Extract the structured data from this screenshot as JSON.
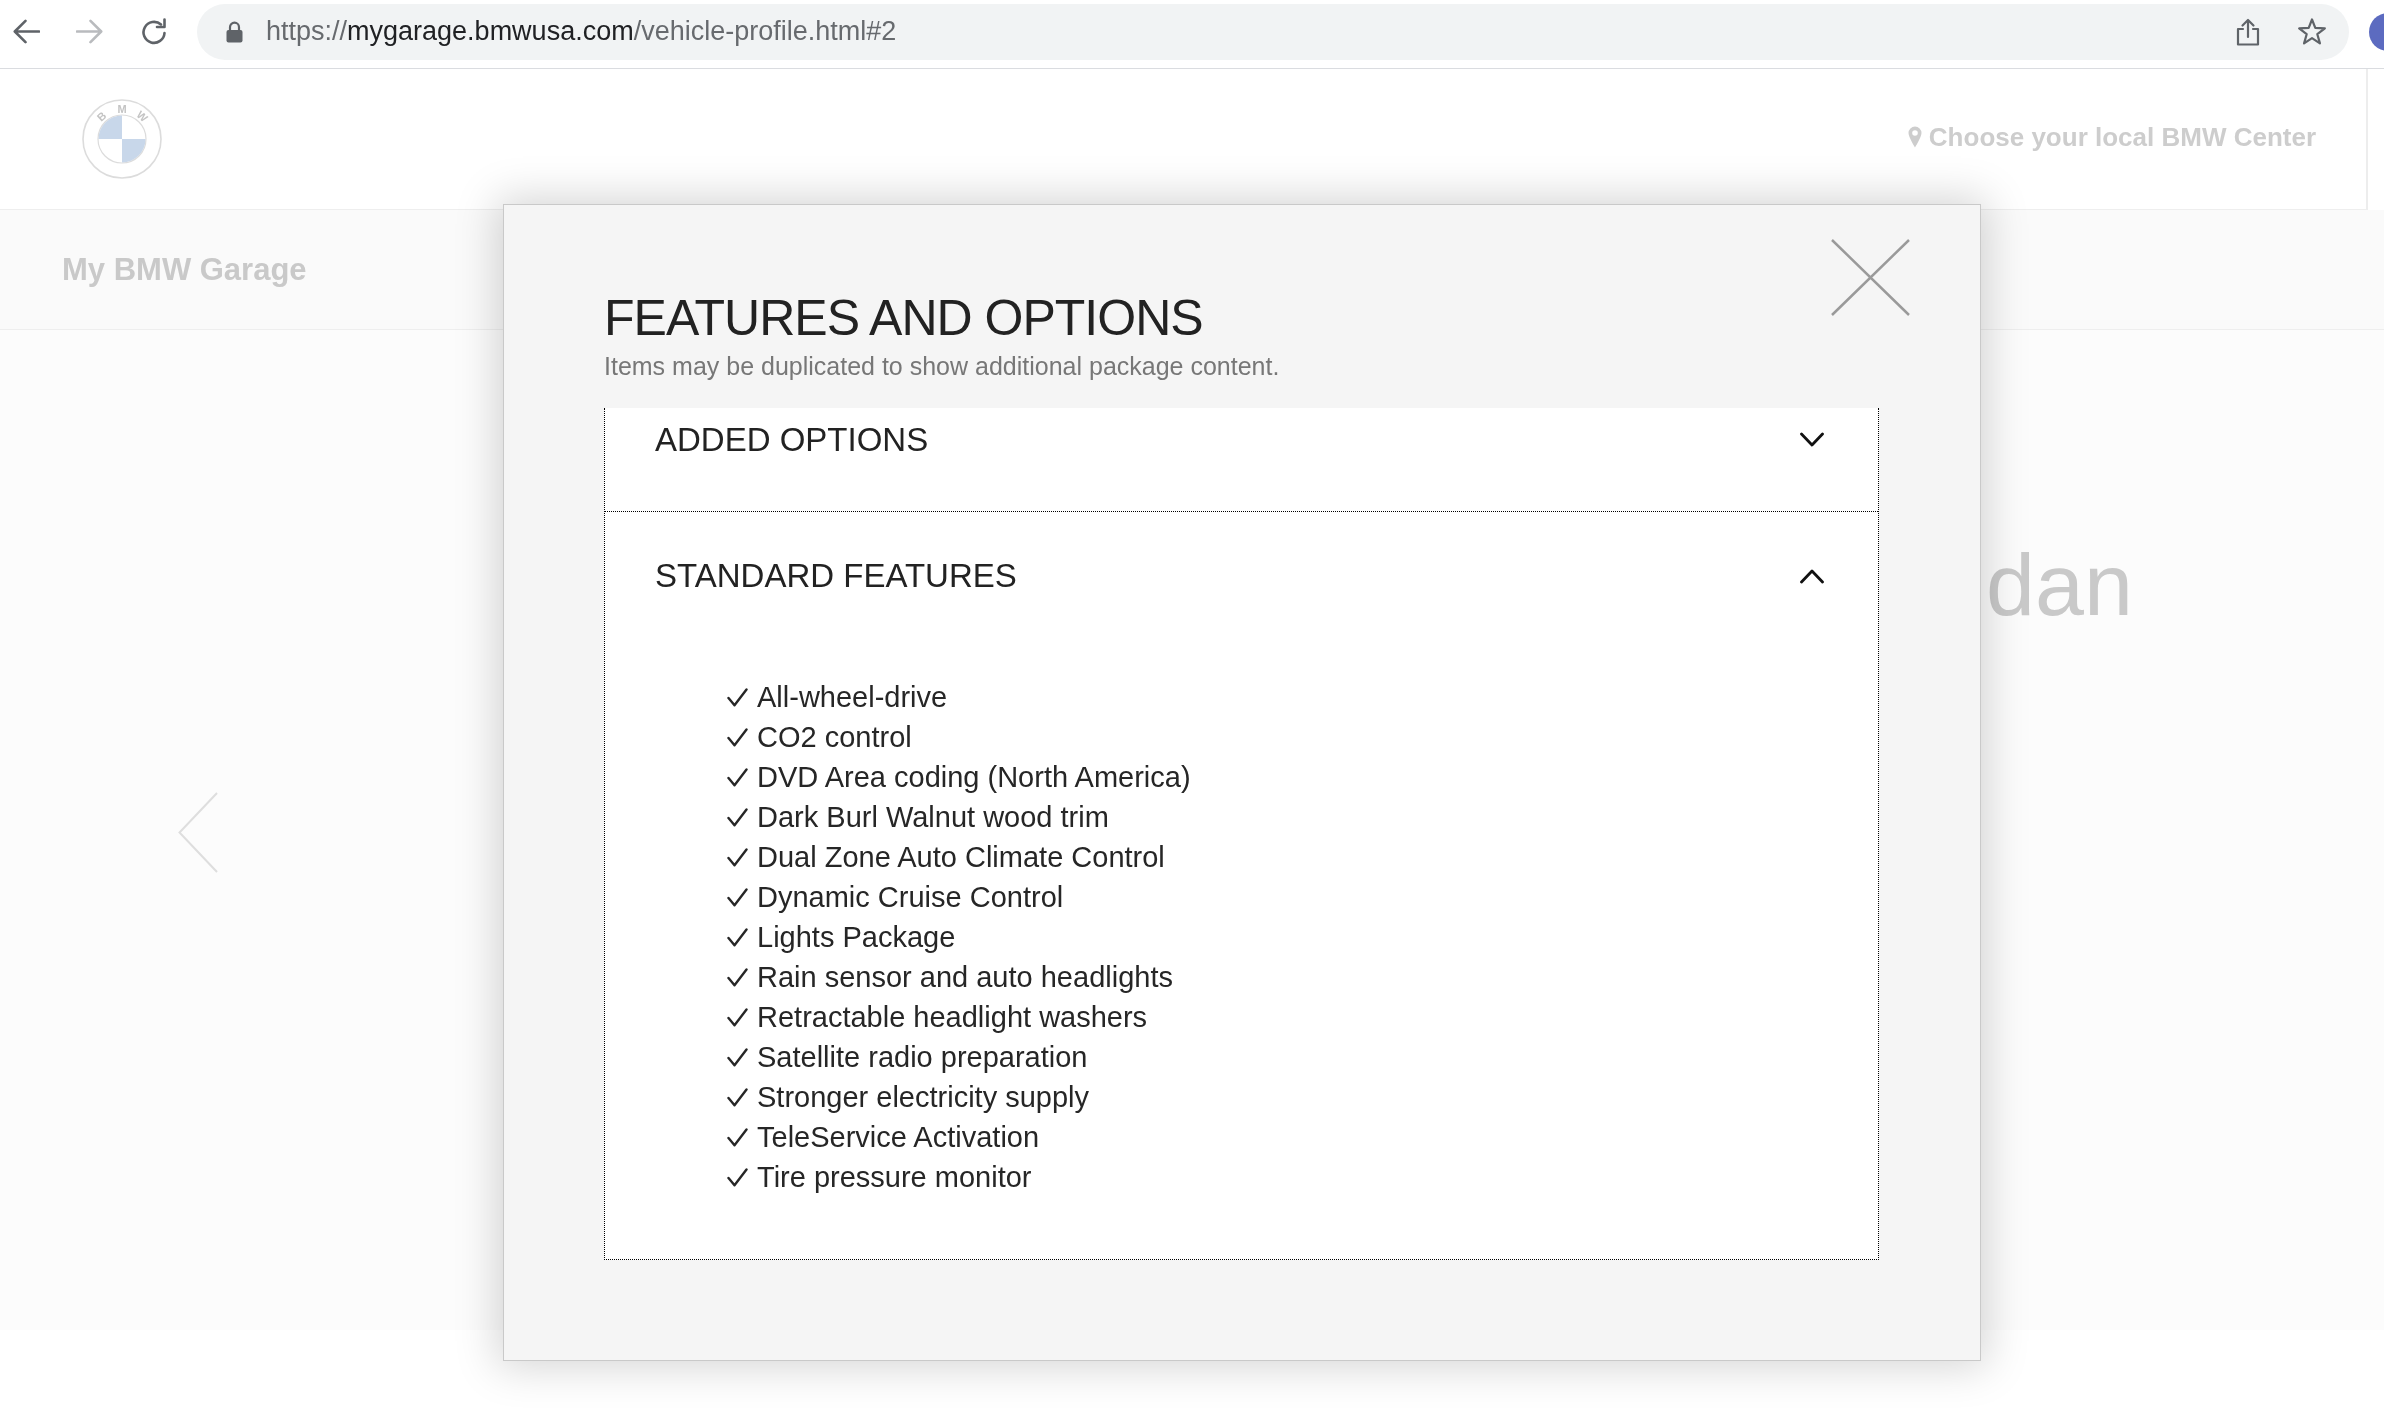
{
  "browser": {
    "nav_buttons": [
      {
        "kind": "back",
        "disabled": false
      },
      {
        "kind": "forward",
        "disabled": true
      },
      {
        "kind": "reload",
        "disabled": false
      }
    ],
    "address": {
      "scheme": "https://",
      "host": "mygarage.bmwusa.com",
      "path": "/vehicle-profile.html#2"
    }
  },
  "site_header": {
    "logo_letters": [
      "B",
      "M",
      "W"
    ],
    "location_link": "Choose your local BMW Center"
  },
  "subnav": {
    "title": "My BMW Garage"
  },
  "page": {
    "heading_fragment": "dan"
  },
  "modal": {
    "title": "FEATURES AND OPTIONS",
    "subtitle": "Items may be duplicated to show additional package content.",
    "sections": [
      {
        "title": "ADDED OPTIONS",
        "expanded": false
      },
      {
        "title": "STANDARD FEATURES",
        "expanded": true,
        "items": [
          "All-wheel-drive",
          "CO2 control",
          "DVD Area coding (North America)",
          "Dark Burl Walnut wood trim",
          "Dual Zone Auto Climate Control",
          "Dynamic Cruise Control",
          "Lights Package",
          "Rain sensor and auto headlights",
          "Retractable headlight washers",
          "Satellite radio preparation",
          "Stronger electricity supply",
          "TeleService Activation",
          "Tire pressure monitor"
        ]
      }
    ]
  }
}
